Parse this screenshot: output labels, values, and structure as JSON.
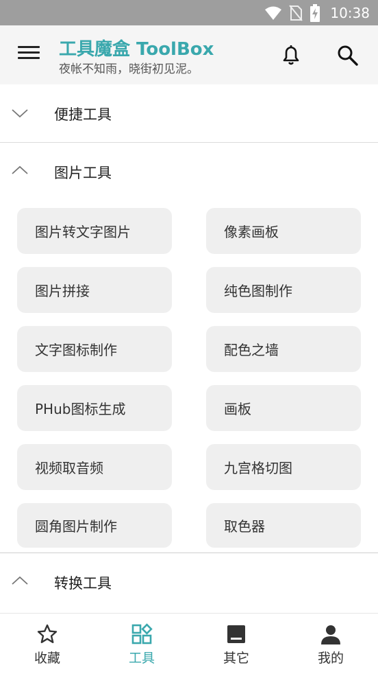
{
  "status_bar": {
    "time": "10:38",
    "icons": [
      "wifi-icon",
      "no-sim-icon",
      "battery-charging-icon"
    ]
  },
  "app_bar": {
    "title": "工具魔盒 ToolBox",
    "subtitle": "夜帐不知雨，晓街初见泥。",
    "icons": [
      "menu-icon",
      "bell-icon",
      "search-icon"
    ]
  },
  "sections": [
    {
      "label": "便捷工具",
      "expanded": false
    },
    {
      "label": "图片工具",
      "expanded": true
    },
    {
      "label": "转换工具",
      "expanded": true
    }
  ],
  "image_tools": [
    "图片转文字图片",
    "像素画板",
    "图片拼接",
    "纯色图制作",
    "文字图标制作",
    "配色之墙",
    "PHub图标生成",
    "画板",
    "视频取音频",
    "九宫格切图",
    "圆角图片制作",
    "取色器"
  ],
  "bottom_nav": [
    {
      "label": "收藏",
      "icon": "star-icon",
      "active": false
    },
    {
      "label": "工具",
      "icon": "grid-icon",
      "active": true
    },
    {
      "label": "其它",
      "icon": "box-icon",
      "active": false
    },
    {
      "label": "我的",
      "icon": "person-icon",
      "active": false
    }
  ],
  "colors": {
    "accent": "#3aa8ad",
    "status_bar": "#9e9e9e",
    "app_bar": "#f5f5f5",
    "tile": "#efefef"
  }
}
